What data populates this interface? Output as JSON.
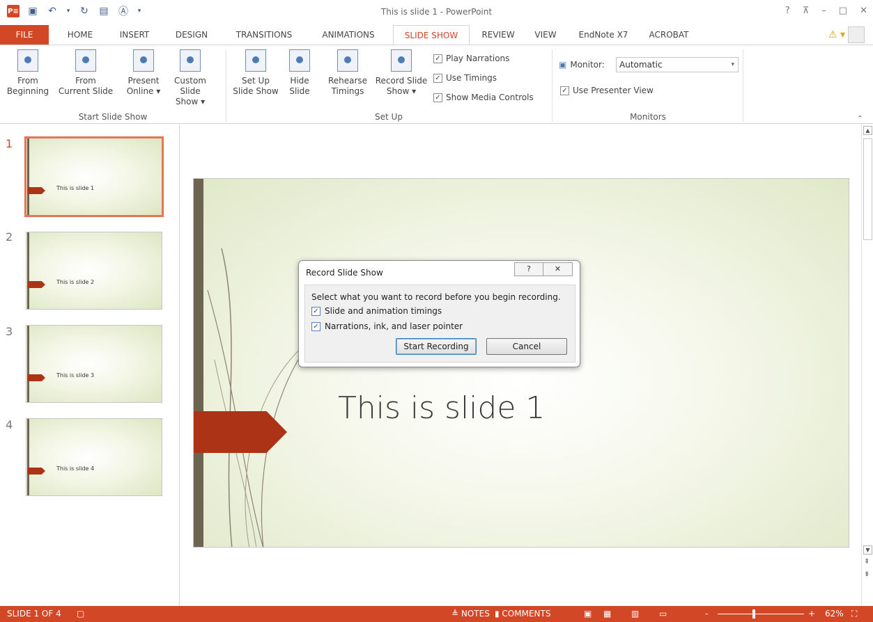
{
  "window": {
    "title": "This is slide 1 - PowerPoint",
    "logo": "P≡",
    "controls": [
      "?",
      "⊼",
      "–",
      "□",
      "✕"
    ]
  },
  "qat": {
    "icons": [
      "save-icon",
      "undo-icon",
      "redo-icon",
      "from-beginning-icon",
      "text-box-icon"
    ],
    "undo_dropdown": "▾",
    "customize": "▾"
  },
  "tabs": [
    {
      "label": "FILE"
    },
    {
      "label": "HOME"
    },
    {
      "label": "INSERT"
    },
    {
      "label": "DESIGN"
    },
    {
      "label": "TRANSITIONS"
    },
    {
      "label": "ANIMATIONS"
    },
    {
      "label": "SLIDE SHOW"
    },
    {
      "label": "REVIEW"
    },
    {
      "label": "VIEW"
    },
    {
      "label": "EndNote X7"
    },
    {
      "label": "ACROBAT"
    }
  ],
  "ribbon": {
    "start_group": {
      "label": "Start Slide Show",
      "buttons": [
        {
          "line1": "From",
          "line2": "Beginning"
        },
        {
          "line1": "From",
          "line2": "Current Slide"
        },
        {
          "line1": "Present",
          "line2": "Online ▾"
        },
        {
          "line1": "Custom Slide",
          "line2": "Show ▾"
        }
      ]
    },
    "setup_group": {
      "label": "Set Up",
      "buttons": [
        {
          "line1": "Set Up",
          "line2": "Slide Show"
        },
        {
          "line1": "Hide",
          "line2": "Slide"
        },
        {
          "line1": "Rehearse",
          "line2": "Timings"
        },
        {
          "line1": "Record Slide",
          "line2": "Show ▾"
        }
      ],
      "checks": [
        {
          "label": "Play Narrations",
          "checked": "✓"
        },
        {
          "label": "Use Timings",
          "checked": "✓"
        },
        {
          "label": "Show Media Controls",
          "checked": "✓"
        }
      ]
    },
    "monitors_group": {
      "label": "Monitors",
      "monitor_label": "Monitor:",
      "monitor_value": "Automatic",
      "presenter_view": {
        "label": "Use Presenter View",
        "checked": "✓"
      }
    }
  },
  "thumbnails": [
    {
      "num": "1",
      "text": "This is slide 1"
    },
    {
      "num": "2",
      "text": "This is slide 2"
    },
    {
      "num": "3",
      "text": "This is slide 3"
    },
    {
      "num": "4",
      "text": "This is slide 4"
    }
  ],
  "slide": {
    "title": "This is slide 1"
  },
  "dialog": {
    "title": "Record Slide Show",
    "help": "?",
    "close": "✕",
    "prompt": "Select what you want to record before you begin recording.",
    "option1": {
      "label": "Slide and animation timings",
      "checked": "✓"
    },
    "option2": {
      "label": "Narrations, ink, and laser pointer",
      "checked": "✓"
    },
    "start_button": "Start Recording",
    "cancel_button": "Cancel"
  },
  "status": {
    "slide_info": "SLIDE 1 OF 4",
    "notes": "≜ NOTES",
    "comments": "▮ COMMENTS",
    "zoom_minus": "-",
    "zoom_plus": "+",
    "zoom": "62%",
    "zoom_level": 0.42
  },
  "colors": {
    "accent": "#d24726",
    "flag": "#ac3316",
    "slide_bar": "#6c6350"
  }
}
